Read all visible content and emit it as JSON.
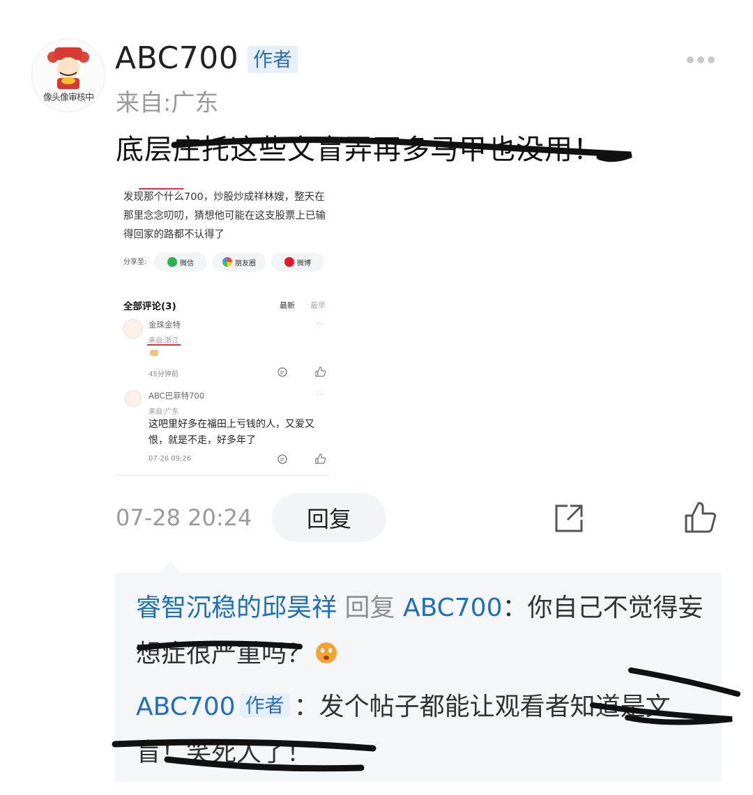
{
  "post": {
    "avatar_review_label": "像头像审核中",
    "username": "ABC700",
    "author_tag": "作者",
    "location": "来自:广东",
    "title": "底层庄托这些文盲弄再多马甲也没用！",
    "time": "07-28 20:24",
    "reply_label": "回复"
  },
  "embedded": {
    "text": "发现那个什么700，炒股炒成祥林嫂，整天在那里念念叨叨，猜想他可能在这支股票上已输得回家的路都不认得了",
    "share_label": "分享至:",
    "share_wechat": "微信",
    "share_moments": "朋友圈",
    "share_weibo": "微博",
    "comments_title": "全部评论(3)",
    "sort_new": "最新",
    "sort_old": "最早",
    "comments": [
      {
        "name": "金珠金特",
        "location": "来自:浙江",
        "time": "45分钟前"
      },
      {
        "name": "ABC巴菲特700",
        "location": "来自:广东",
        "body": "这吧里好多在福田上亏钱的人，又爱又恨，就是不走，好多年了",
        "time": "07-26 09:26"
      }
    ]
  },
  "replies": [
    {
      "user": "睿智沉稳的邱昊祥",
      "reply_word": "回复",
      "target": "ABC700",
      "text": "你自己不觉得妄想症很严重吗？"
    },
    {
      "user": "ABC700",
      "tag": "作者",
      "text": "发个帖子都能让观看者知道是文盲！笑死人了！"
    }
  ],
  "colors": {
    "link_blue": "#1f6fbf",
    "tag_bg": "#e6f0fb",
    "reply_bg": "#f5f6f8"
  }
}
